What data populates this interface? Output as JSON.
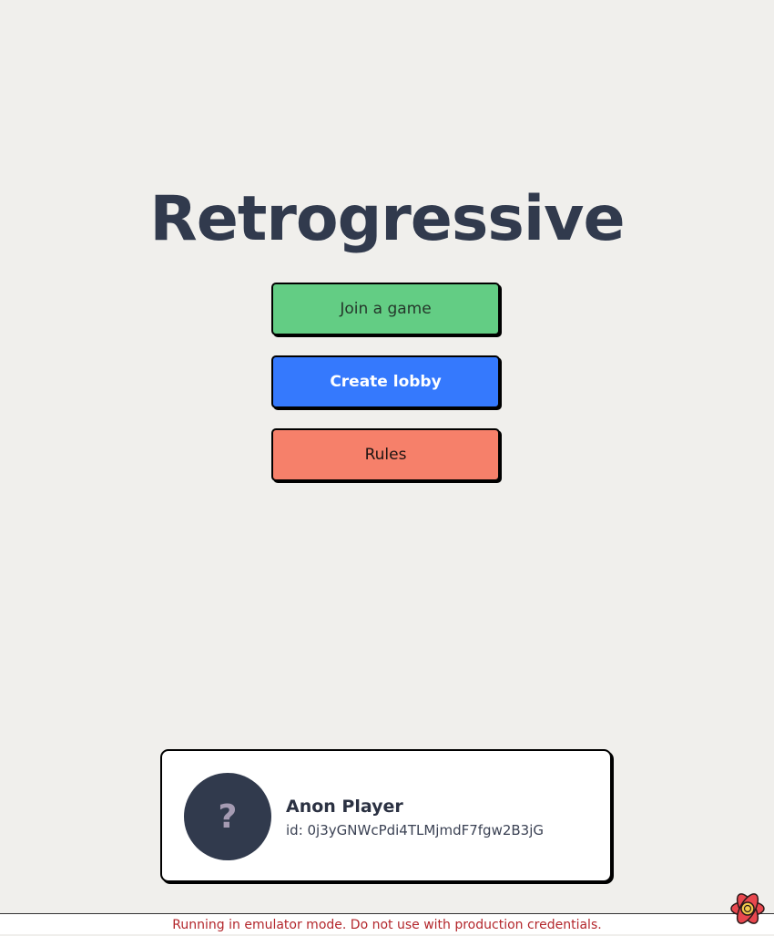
{
  "app": {
    "title": "Retrogressive"
  },
  "menu": {
    "join_label": "Join a game",
    "create_label": "Create lobby",
    "rules_label": "Rules"
  },
  "player": {
    "avatar_glyph": "?",
    "name": "Anon Player",
    "id_text": "id: 0j3yGNWcPdi4TLMjmdF7fgw2B3jG"
  },
  "footer": {
    "warning": "Running in emulator mode. Do not use with production credentials."
  },
  "colors": {
    "background": "#f0efec",
    "title": "#313a4d",
    "join_button": "#63cd84",
    "create_button": "#3579fd",
    "rules_button": "#f6806a",
    "avatar": "#313a4d",
    "warning_text": "#b3262b"
  },
  "icons": {
    "emulator": "emulator-icon"
  }
}
